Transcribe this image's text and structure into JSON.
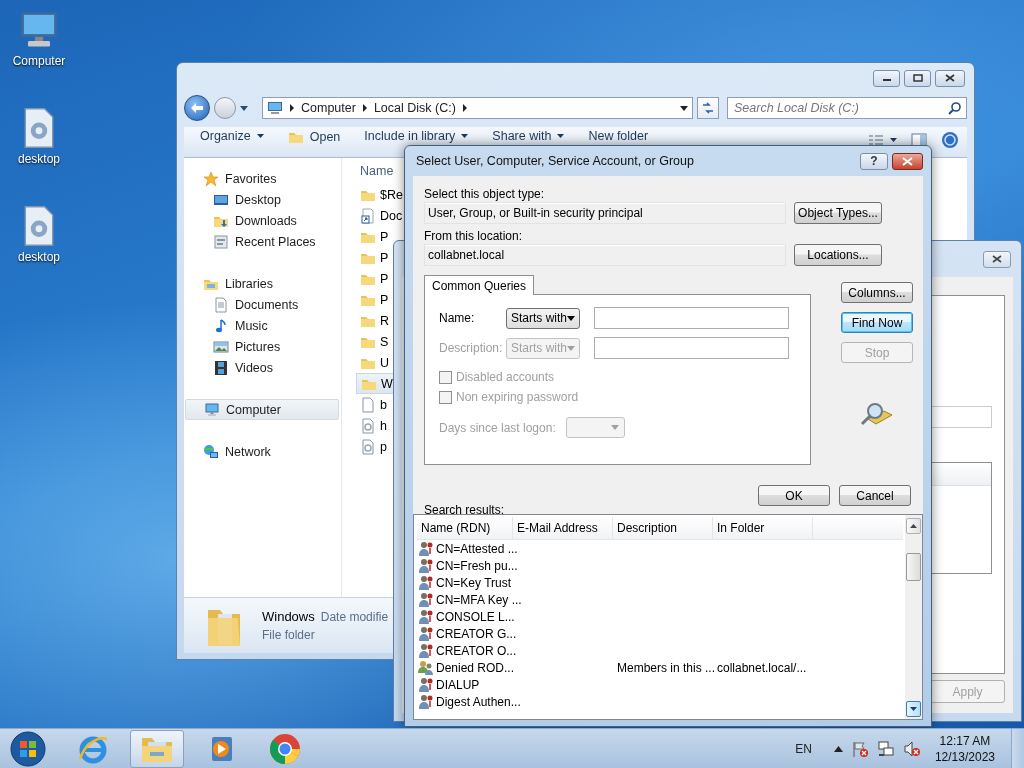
{
  "desktop_icons": [
    {
      "label": "Computer",
      "kind": "computer"
    },
    {
      "label": "desktop",
      "kind": "document"
    },
    {
      "label": "desktop",
      "kind": "document"
    }
  ],
  "explorer": {
    "breadcrumbs": [
      "Computer",
      "Local Disk (C:)"
    ],
    "search": {
      "placeholder": "Search Local Disk (C:)"
    },
    "toolbar": [
      {
        "label": "Organize",
        "kind": "menu"
      },
      {
        "label": "Open",
        "kind": "open"
      },
      {
        "label": "Include in library",
        "kind": "menu"
      },
      {
        "label": "Share with",
        "kind": "menu"
      },
      {
        "label": "New folder",
        "kind": "command"
      }
    ],
    "nav": [
      {
        "label": "Favorites",
        "kind": "star",
        "selected": false,
        "children": [
          {
            "label": "Desktop",
            "kind": "desktop",
            "selected": false
          },
          {
            "label": "Downloads",
            "kind": "downloads",
            "selected": false
          },
          {
            "label": "Recent Places",
            "kind": "recent",
            "selected": false
          }
        ]
      },
      {
        "label": "Libraries",
        "kind": "libraries",
        "selected": false,
        "children": [
          {
            "label": "Documents",
            "kind": "documents",
            "selected": false
          },
          {
            "label": "Music",
            "kind": "music",
            "selected": false
          },
          {
            "label": "Pictures",
            "kind": "pictures",
            "selected": false
          },
          {
            "label": "Videos",
            "kind": "videos",
            "selected": false
          }
        ]
      },
      {
        "label": "Computer",
        "kind": "computer",
        "selected": true
      },
      {
        "label": "Network",
        "kind": "network",
        "selected": false
      }
    ],
    "column": "Name",
    "files": [
      {
        "name": "$Re",
        "kind": "folder",
        "selected": false
      },
      {
        "name": "Doc",
        "kind": "shortcut",
        "selected": false
      },
      {
        "name": "P",
        "kind": "folder",
        "selected": false
      },
      {
        "name": "P",
        "kind": "folder",
        "selected": false
      },
      {
        "name": "P",
        "kind": "folder",
        "selected": false
      },
      {
        "name": "P",
        "kind": "folder",
        "selected": false
      },
      {
        "name": "R",
        "kind": "folder",
        "selected": false
      },
      {
        "name": "S",
        "kind": "folder",
        "selected": false
      },
      {
        "name": "U",
        "kind": "folder",
        "selected": false
      },
      {
        "name": "W",
        "kind": "folder",
        "selected": true
      },
      {
        "name": "b",
        "kind": "file",
        "selected": false
      },
      {
        "name": "h",
        "kind": "system",
        "selected": false
      },
      {
        "name": "p",
        "kind": "system",
        "selected": false
      }
    ],
    "details": {
      "name": "Windows",
      "meta": "Date modifie",
      "type": "File folder"
    }
  },
  "back_window": {
    "apply_button": {
      "label": "Apply",
      "disabled": true
    }
  },
  "dialog": {
    "title": "Select User, Computer, Service Account, or Group",
    "help": "?",
    "object_type": {
      "label": "Select this object type:",
      "value": "User, Group, or Built-in security principal",
      "button": "Object Types..."
    },
    "location": {
      "label": "From this location:",
      "value": "collabnet.local",
      "button": "Locations..."
    },
    "tabs": [
      {
        "label": "Common Queries",
        "selected": true
      }
    ],
    "queries": [
      {
        "label": "Name:",
        "match": "Starts with",
        "disabled": false
      },
      {
        "label": "Description:",
        "match": "Starts with",
        "disabled": true
      }
    ],
    "checkboxes": [
      {
        "label": "Disabled accounts",
        "checked": false,
        "disabled": true
      },
      {
        "label": "Non expiring password",
        "checked": false,
        "disabled": true
      }
    ],
    "days": {
      "label": "Days since last logon:",
      "disabled": true
    },
    "side_buttons": [
      {
        "label": "Columns...",
        "default": false,
        "disabled": false
      },
      {
        "label": "Find Now",
        "default": true,
        "disabled": false
      },
      {
        "label": "Stop",
        "default": false,
        "disabled": true
      }
    ],
    "buttons": [
      {
        "label": "OK"
      },
      {
        "label": "Cancel"
      }
    ],
    "results_label": "Search results:",
    "columns": [
      "Name (RDN)",
      "E-Mail Address",
      "Description",
      "In Folder"
    ],
    "rows": [
      {
        "kind": "principal",
        "name": "CN=Attested ..."
      },
      {
        "kind": "principal",
        "name": "CN=Fresh pu..."
      },
      {
        "kind": "principal",
        "name": "CN=Key Trust"
      },
      {
        "kind": "principal",
        "name": "CN=MFA Key ..."
      },
      {
        "kind": "principal",
        "name": "CONSOLE L..."
      },
      {
        "kind": "principal",
        "name": "CREATOR G..."
      },
      {
        "kind": "principal",
        "name": "CREATOR O..."
      },
      {
        "kind": "group",
        "name": "Denied ROD...",
        "description": "Members in this ...",
        "folder": "collabnet.local/..."
      },
      {
        "kind": "principal",
        "name": "DIALUP"
      },
      {
        "kind": "principal",
        "name": "Digest Authen..."
      }
    ]
  },
  "taskbar": {
    "apps": [
      {
        "kind": "ie",
        "active": false
      },
      {
        "kind": "explorer",
        "active": true
      },
      {
        "kind": "media",
        "active": false
      },
      {
        "kind": "chrome",
        "active": false
      }
    ],
    "language": "EN",
    "time": "12:17 AM",
    "date": "12/13/2023"
  }
}
